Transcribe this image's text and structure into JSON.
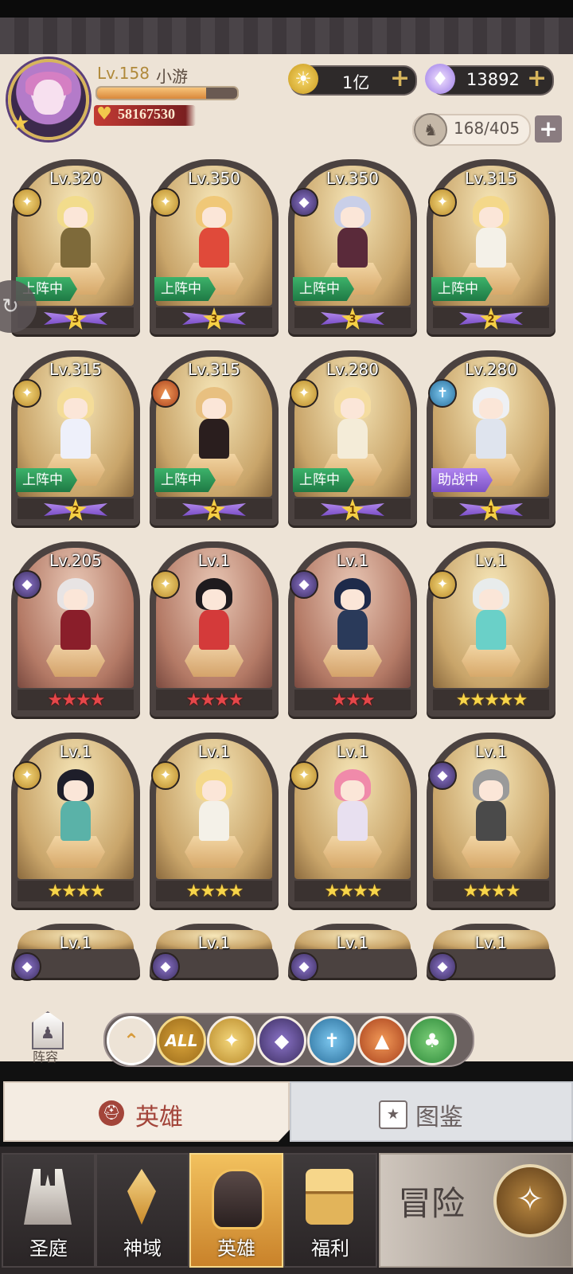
{
  "player": {
    "level_label": "Lv.158",
    "name": "小游",
    "power": "58167530",
    "exp_fraction": 0.78
  },
  "resources": {
    "gold": "1亿",
    "diamonds": "13892",
    "team": "168/405",
    "plus": "+"
  },
  "cards": [
    {
      "lv": "Lv.320",
      "faction": "sun",
      "bg": "gold",
      "status": "上阵中",
      "status_type": "onstage",
      "rank": "3",
      "hair": "#f2dc8c",
      "body": "#7e6a3a"
    },
    {
      "lv": "Lv.350",
      "faction": "sun",
      "bg": "gold",
      "status": "上阵中",
      "status_type": "onstage",
      "rank": "3",
      "hair": "#f0c878",
      "body": "#e04a3a"
    },
    {
      "lv": "Lv.350",
      "faction": "dark",
      "bg": "gold",
      "status": "上阵中",
      "status_type": "onstage",
      "rank": "3",
      "hair": "#c9cfe8",
      "body": "#5a2a3a"
    },
    {
      "lv": "Lv.315",
      "faction": "sun",
      "bg": "gold",
      "status": "上阵中",
      "status_type": "onstage",
      "rank": "2",
      "hair": "#f4d88a",
      "body": "#f4f1e8"
    },
    {
      "lv": "Lv.315",
      "faction": "sun",
      "bg": "gold",
      "status": "上阵中",
      "status_type": "onstage",
      "rank": "2",
      "hair": "#f4dc98",
      "body": "#eef0fa"
    },
    {
      "lv": "Lv.315",
      "faction": "wolf",
      "bg": "gold",
      "status": "上阵中",
      "status_type": "onstage",
      "rank": "2",
      "hair": "#e8c080",
      "body": "#2a1e1e"
    },
    {
      "lv": "Lv.280",
      "faction": "sun",
      "bg": "gold",
      "status": "上阵中",
      "status_type": "onstage",
      "rank": "1",
      "hair": "#f4dca0",
      "body": "#f4ecd8"
    },
    {
      "lv": "Lv.280",
      "faction": "holy",
      "bg": "gold",
      "status": "助战中",
      "status_type": "assist",
      "rank": "1",
      "hair": "#eef0f4",
      "body": "#dfe4ee"
    },
    {
      "lv": "Lv.205",
      "faction": "dark",
      "bg": "red",
      "stars": "★★★★",
      "star_color": "red",
      "hair": "#e8e4e4",
      "body": "#8a1e2a"
    },
    {
      "lv": "Lv.1",
      "faction": "sun",
      "bg": "red",
      "stars": "★★★★",
      "star_color": "red",
      "hair": "#1e1a1e",
      "body": "#d43a3a"
    },
    {
      "lv": "Lv.1",
      "faction": "dark",
      "bg": "red",
      "stars": "★★★",
      "star_color": "red",
      "hair": "#1e2a4a",
      "body": "#2a3a5a"
    },
    {
      "lv": "Lv.1",
      "faction": "sun",
      "bg": "gold",
      "stars": "★★★★★",
      "star_color": "gold",
      "hair": "#e8ecec",
      "body": "#6ad0c8"
    },
    {
      "lv": "Lv.1",
      "faction": "sun",
      "bg": "gold",
      "stars": "★★★★",
      "star_color": "gold",
      "hair": "#1e1e2a",
      "body": "#5ab2a8"
    },
    {
      "lv": "Lv.1",
      "faction": "sun",
      "bg": "gold",
      "stars": "★★★★",
      "star_color": "gold",
      "hair": "#f4d88a",
      "body": "#f4f1e8"
    },
    {
      "lv": "Lv.1",
      "faction": "sun",
      "bg": "gold",
      "stars": "★★★★",
      "star_color": "gold",
      "hair": "#f08aaa",
      "body": "#e8e0f0"
    },
    {
      "lv": "Lv.1",
      "faction": "dark",
      "bg": "gold",
      "stars": "★★★★",
      "star_color": "gold",
      "hair": "#9a9a9a",
      "body": "#4a4a4a"
    },
    {
      "lv": "Lv.1",
      "faction": "dark",
      "bg": "gold"
    },
    {
      "lv": "Lv.1",
      "faction": "dark",
      "bg": "gold"
    },
    {
      "lv": "Lv.1",
      "faction": "dark",
      "bg": "gold"
    },
    {
      "lv": "Lv.1",
      "faction": "dark",
      "bg": "gold"
    }
  ],
  "lineup_label": "阵容",
  "filters": {
    "all": "ALL"
  },
  "tabs": {
    "hero": "英雄",
    "dex": "图鉴"
  },
  "nav": {
    "court": "圣庭",
    "domain": "神域",
    "hero": "英雄",
    "welfare": "福利",
    "adventure": "冒险"
  },
  "colors": {
    "onstage": "#2f9a58",
    "assist": "#9a6ee0",
    "accent": "#d7b55c"
  }
}
